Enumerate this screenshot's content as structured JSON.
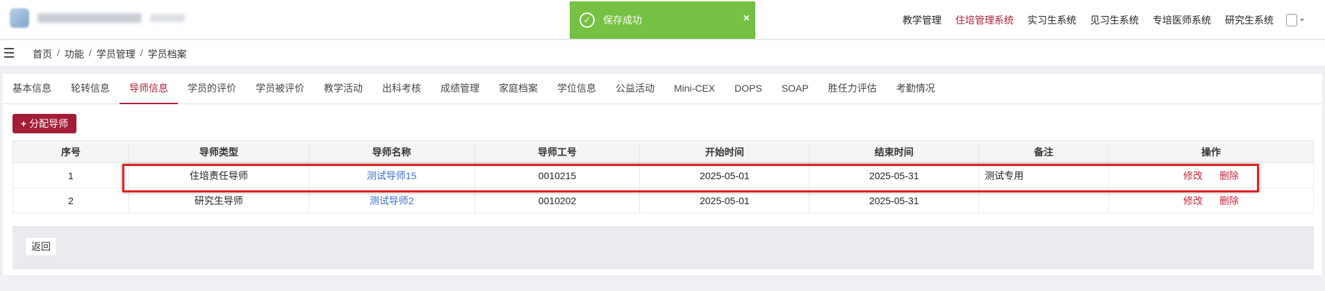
{
  "toast": {
    "message": "保存成功",
    "close": "×"
  },
  "system_nav": [
    {
      "label": "教学管理",
      "active": false
    },
    {
      "label": "住培管理系统",
      "active": true
    },
    {
      "label": "实习生系统",
      "active": false
    },
    {
      "label": "见习生系统",
      "active": false
    },
    {
      "label": "专培医师系统",
      "active": false
    },
    {
      "label": "研究生系统",
      "active": false
    }
  ],
  "breadcrumb": [
    "首页",
    "功能",
    "学员管理",
    "学员档案"
  ],
  "breadcrumb_sep": "/",
  "tabs": [
    {
      "label": "基本信息",
      "active": false
    },
    {
      "label": "轮转信息",
      "active": false
    },
    {
      "label": "导师信息",
      "active": true
    },
    {
      "label": "学员的评价",
      "active": false
    },
    {
      "label": "学员被评价",
      "active": false
    },
    {
      "label": "教学活动",
      "active": false
    },
    {
      "label": "出科考核",
      "active": false
    },
    {
      "label": "成绩管理",
      "active": false
    },
    {
      "label": "家庭档案",
      "active": false
    },
    {
      "label": "学位信息",
      "active": false
    },
    {
      "label": "公益活动",
      "active": false
    },
    {
      "label": "Mini-CEX",
      "active": false
    },
    {
      "label": "DOPS",
      "active": false
    },
    {
      "label": "SOAP",
      "active": false
    },
    {
      "label": "胜任力评估",
      "active": false
    },
    {
      "label": "考勤情况",
      "active": false
    }
  ],
  "assign_button": {
    "icon": "+",
    "label": "分配导师"
  },
  "table": {
    "headers": [
      "序号",
      "导师类型",
      "导师名称",
      "导师工号",
      "开始时间",
      "结束时间",
      "备注",
      "操作"
    ],
    "rows": [
      {
        "index": "1",
        "type": "住培责任导师",
        "name": "测试导师15",
        "id": "0010215",
        "start": "2025-05-01",
        "end": "2025-05-31",
        "note": "测试专用",
        "edit": "修改",
        "delete": "删除"
      },
      {
        "index": "2",
        "type": "研究生导师",
        "name": "测试导师2",
        "id": "0010202",
        "start": "2025-05-01",
        "end": "2025-05-31",
        "note": "",
        "edit": "修改",
        "delete": "删除"
      }
    ]
  },
  "back_button": "返回",
  "colors": {
    "accent": "#a8203a",
    "toast": "#76c043",
    "link": "#3a6fc4",
    "highlight": "#e02020"
  }
}
